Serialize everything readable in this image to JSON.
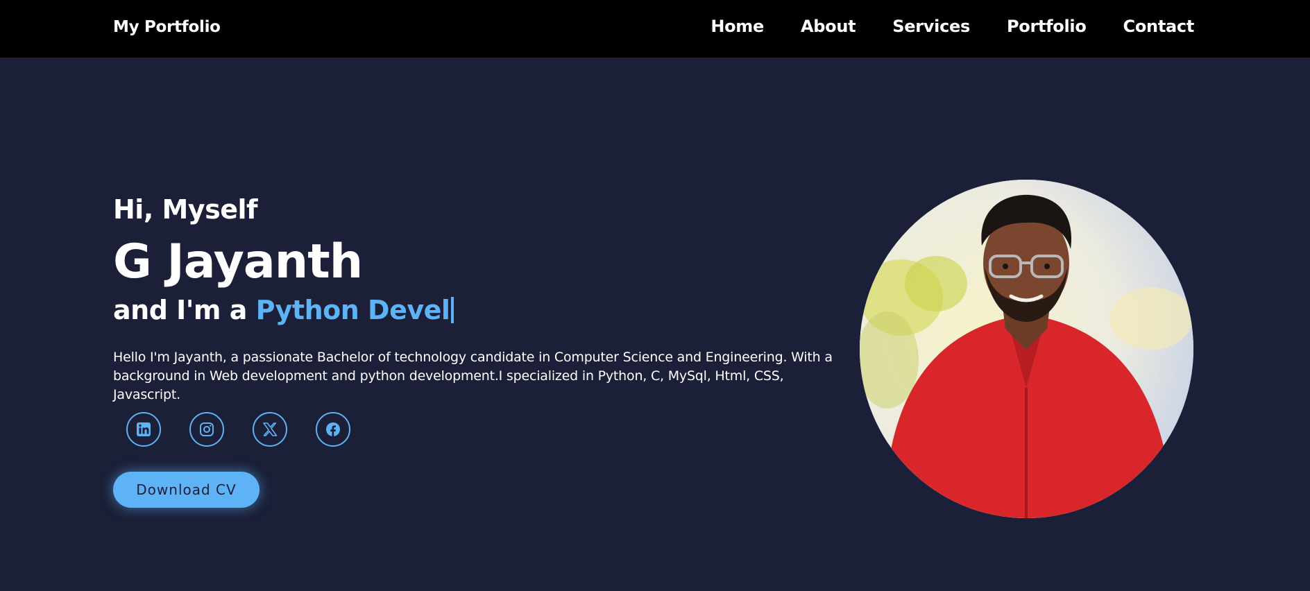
{
  "nav": {
    "logo": "My Portfolio",
    "links": [
      "Home",
      "About",
      "Services",
      "Portfolio",
      "Contact"
    ]
  },
  "hero": {
    "greeting": "Hi, Myself",
    "name": "G Jayanth",
    "role_prefix": "and I'm a",
    "role_typed": "Python Devel",
    "bio": "Hello I'm Jayanth, a passionate Bachelor of technology candidate in Computer Science and Engineering. With a background in Web development and python development.I specialized in Python, C, MySql, Html, CSS, Javascript.",
    "socials": [
      "linkedin-icon",
      "instagram-icon",
      "x-icon",
      "facebook-icon"
    ],
    "cv_button": "Download CV"
  },
  "colors": {
    "background": "#1b1f37",
    "navbar": "#000000",
    "accent": "#5eb3f6",
    "shirt": "#d8262b"
  }
}
